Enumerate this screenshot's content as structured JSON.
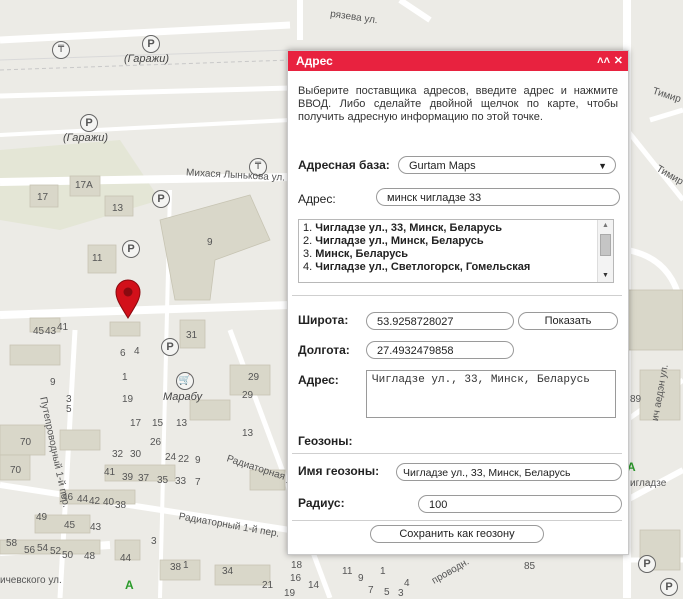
{
  "map": {
    "labels": {
      "garages_1": "(Гаражи)",
      "garages_2": "(Гаражи)",
      "street_1": "Михася Лынькова ул.",
      "street_2": "рязева ул.",
      "street_3": "Путепроводный 1-й пер.",
      "street_4": "Радиаторный 1-й пер.",
      "street_5": "Радиаторная ул.",
      "street_6": "Радиаторный 1-й пер.",
      "street_7": "Тимир",
      "street_8": "Тимир",
      "street_9": "ич аедэн ул.",
      "street_10": "игладзе",
      "street_11": "ичевского ул.",
      "street_12": "проводн.",
      "shop": "Марабу",
      "n_17": "17",
      "n_17a": "17А",
      "n_13": "13",
      "n_9": "9",
      "n_11": "11",
      "n_45": "45",
      "n_43": "43",
      "n_41": "41",
      "n_31": "31",
      "n_6": "6",
      "n_4": "4",
      "n_9b": "9",
      "n_1": "1",
      "n_19": "19",
      "n_29": "29",
      "n_29b": "29",
      "n_5": "5",
      "n_3": "3",
      "n_17b": "17",
      "n_15": "15",
      "n_13b": "13",
      "n_70": "70",
      "n_26": "26",
      "n_32": "32",
      "n_30": "30",
      "n_24": "24",
      "n_22": "22",
      "n_9c": "9",
      "n_70b": "70",
      "n_41b": "41",
      "n_39": "39",
      "n_37": "37",
      "n_35": "35",
      "n_33": "33",
      "n_7": "7",
      "n_46": "46",
      "n_44": "44",
      "n_42": "42",
      "n_40": "40",
      "n_38": "38",
      "n_49": "49",
      "n_45b": "45",
      "n_43b": "43",
      "n_58": "58",
      "n_56": "56",
      "n_54": "54",
      "n_52": "52",
      "n_50": "50",
      "n_48": "48",
      "n_44b": "44",
      "n_38b": "38",
      "n_3b": "3",
      "n_1b": "1",
      "n_34": "34",
      "n_21": "21",
      "n_19b": "19",
      "n_18": "18",
      "n_16": "16",
      "n_14": "14",
      "n_11b": "11",
      "n_9d": "9",
      "n_7b": "7",
      "n_5b": "5",
      "n_3c": "3",
      "n_1c": "1",
      "n_4b": "4",
      "n_85": "85",
      "n_89": "89",
      "n_13c": "13",
      "n_a1": "A",
      "n_a2": "A",
      "p": "P",
      "t": "₸"
    },
    "colors": {
      "background": "#ecebe6",
      "road": "#ffffff",
      "building": "#d9d7c9",
      "park": "#dfe6cf",
      "marker": "#d2101a"
    }
  },
  "dialog": {
    "title": "Адрес",
    "collapse_icon": "double-chevron-up-icon",
    "close_icon": "close-icon",
    "intro": "Выберите поставщика адресов, введите адрес и нажмите ВВОД. Либо сделайте двойной щелчок по карте, чтобы получить адресную информацию по этой точке.",
    "address_base_label": "Адресная база:",
    "address_base_value": "Gurtam Maps",
    "address_label": "Адрес:",
    "address_value": "минск чигладзе 33",
    "results": [
      {
        "n": "1.",
        "text": "Чигладзе ул., 33, Минск, Беларусь"
      },
      {
        "n": "2.",
        "text": "Чигладзе ул., Минск, Беларусь"
      },
      {
        "n": "3.",
        "text": "Минск, Беларусь"
      },
      {
        "n": "4.",
        "text": "Чигладзе ул., Светлогорск, Гомельская"
      }
    ],
    "latitude_label": "Широта:",
    "latitude_value": "53.9258728027",
    "show_button": "Показать",
    "longitude_label": "Долгота:",
    "longitude_value": "27.4932479858",
    "address2_label": "Адрес:",
    "address2_value": "Чигладзе ул., 33, Минск, Беларусь",
    "geozones_label": "Геозоны:",
    "geozone_name_label": "Имя геозоны:",
    "geozone_name_value": "Чигладзе ул., 33, Минск, Беларусь",
    "radius_label": "Радиус:",
    "radius_value": "100",
    "save_button": "Сохранить как геозону",
    "header_color": "#e8223f"
  }
}
